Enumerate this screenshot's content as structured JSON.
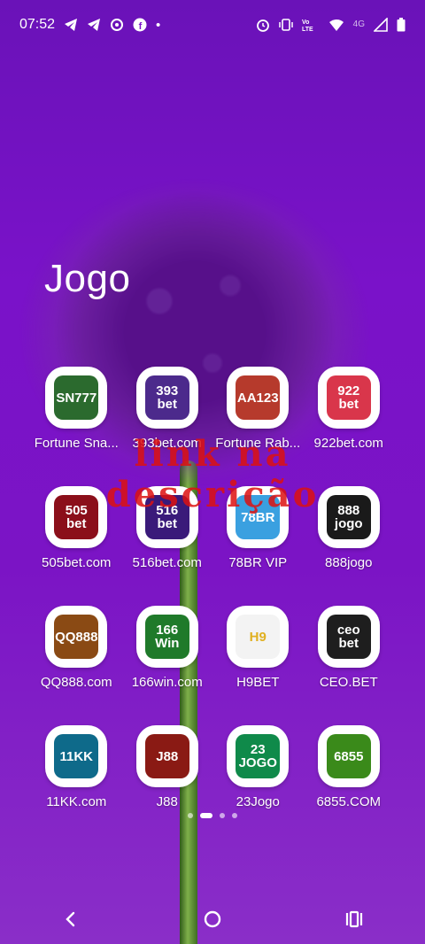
{
  "status": {
    "time": "07:52",
    "network_label": "4G",
    "left_icons": [
      "telegram-icon",
      "telegram-icon",
      "signal-app-icon",
      "facebook-icon",
      "dot-icon"
    ],
    "right_icons": [
      "alarm-icon",
      "vibrate-icon",
      "volte-icon",
      "wifi-icon",
      "cell-signal-icon",
      "battery-icon"
    ]
  },
  "folder": {
    "title": "Jogo"
  },
  "apps": [
    {
      "label": "Fortune Sna...",
      "logo_text": "SN777",
      "bg": "#2b6a2e"
    },
    {
      "label": "393bet.com",
      "logo_text": "393\nbet",
      "bg": "#4c2a8c"
    },
    {
      "label": "Fortune Rab...",
      "logo_text": "AA123",
      "bg": "#b63a2c"
    },
    {
      "label": "922bet.com",
      "logo_text": "922\nbet",
      "bg": "#d9364b"
    },
    {
      "label": "505bet.com",
      "logo_text": "505\nbet",
      "bg": "#8b0f1a"
    },
    {
      "label": "516bet.com",
      "logo_text": "516\nbet",
      "bg": "#3a1a7a"
    },
    {
      "label": "78BR VIP",
      "logo_text": "78BR",
      "bg": "#3aa0e0"
    },
    {
      "label": "888jogo",
      "logo_text": "888\njogo",
      "bg": "#1a1a1a"
    },
    {
      "label": "QQ888.com",
      "logo_text": "QQ888",
      "bg": "#8a4a14"
    },
    {
      "label": "166win.com",
      "logo_text": "166\nWin",
      "bg": "#1f7a2a"
    },
    {
      "label": "H9BET",
      "logo_text": "H9",
      "bg": "#f3f3f3"
    },
    {
      "label": "CEO.BET",
      "logo_text": "ceo\nbet",
      "bg": "#1e1e1e"
    },
    {
      "label": "11KK.com",
      "logo_text": "11KK",
      "bg": "#0e6a8a"
    },
    {
      "label": "J88",
      "logo_text": "J88",
      "bg": "#8a1a14"
    },
    {
      "label": "23Jogo",
      "logo_text": "23\nJOGO",
      "bg": "#0f8a4a"
    },
    {
      "label": "6855.COM",
      "logo_text": "6855",
      "bg": "#3a8a1a"
    }
  ],
  "overlay_text": "link na descrição",
  "pager": {
    "pages": 4,
    "active": 1
  },
  "nav": [
    "back-icon",
    "home-icon",
    "recents-icon"
  ]
}
